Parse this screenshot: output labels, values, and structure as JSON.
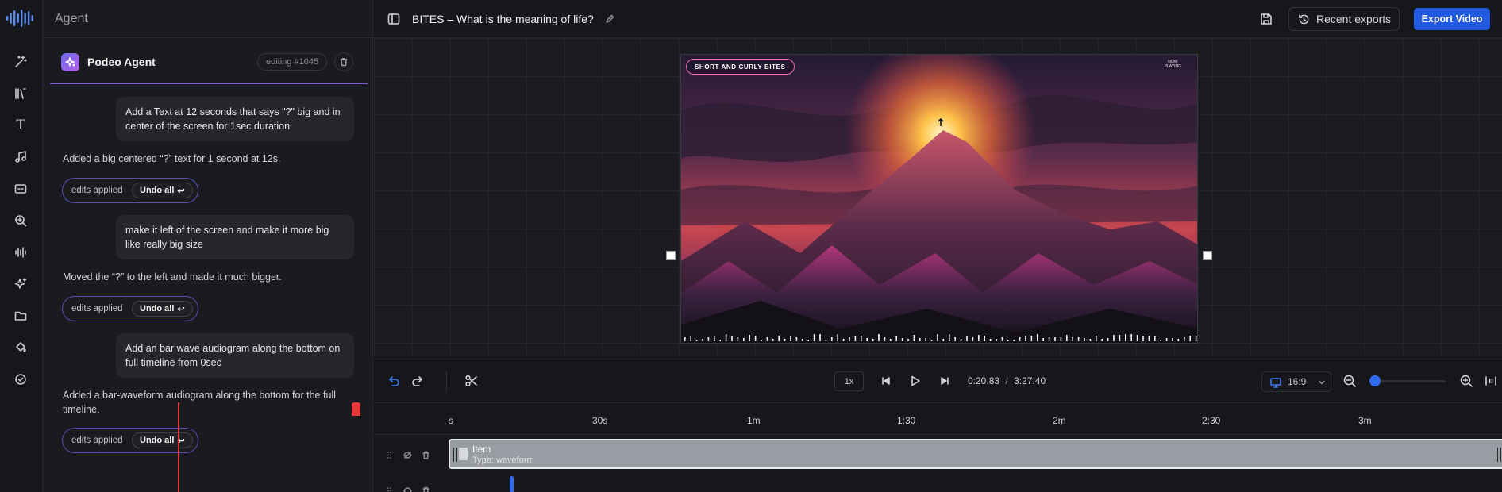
{
  "rail": {
    "tools": [
      "magic-wand-icon",
      "library-icon",
      "text-icon",
      "music-icon",
      "captions-icon",
      "zoom-icon",
      "audiogram-icon",
      "sparkle-icon",
      "folder-icon",
      "paint-bucket-icon",
      "check-circle-icon"
    ],
    "text_tool_glyph": "T"
  },
  "agent": {
    "header_title": "Agent",
    "name": "Podeo Agent",
    "editing_badge": "editing #1045",
    "messages": [
      {
        "role": "user",
        "text": "Add a Text  at 12 seconds that says \"?\" big and in center of the screen for 1sec duration"
      },
      {
        "role": "bot",
        "text": "Added a big centered “?” text for 1 second at 12s."
      },
      {
        "role": "user",
        "text": "make it left of the screen and make it more big like really big size"
      },
      {
        "role": "bot",
        "text": "Moved the “?” to the left and made it much bigger."
      },
      {
        "role": "user",
        "text": "Add an bar wave audiogram along the bottom on full timeline from 0sec"
      },
      {
        "role": "bot",
        "text": "Added a bar-waveform audiogram along the bottom for the full timeline."
      }
    ],
    "edits_applied_label": "edits applied",
    "undo_label": "Undo all",
    "undo_glyph": "↩"
  },
  "topbar": {
    "project_title": "BITES – What is the meaning of life?",
    "recent_exports": "Recent exports",
    "export_button": "Export Video"
  },
  "preview": {
    "badge": "SHORT AND CURLY BITES",
    "now_playing_line1": "NOW",
    "now_playing_line2": "PLAYING"
  },
  "transport": {
    "speed": "1x",
    "current_time": "0:20.83",
    "separator": "/",
    "total_time": "3:27.40",
    "aspect_ratio": "16:9",
    "zoom_level": 0.0
  },
  "timeline": {
    "ruler_labels": [
      "s",
      "30s",
      "1m",
      "1:30",
      "2m",
      "2:30",
      "3m"
    ],
    "clip": {
      "label": "Item",
      "type": "Type: waveform"
    }
  },
  "colors": {
    "accent": "#2159e0",
    "agent_underline": "#7b5ce6",
    "playhead": "#e5383b"
  }
}
